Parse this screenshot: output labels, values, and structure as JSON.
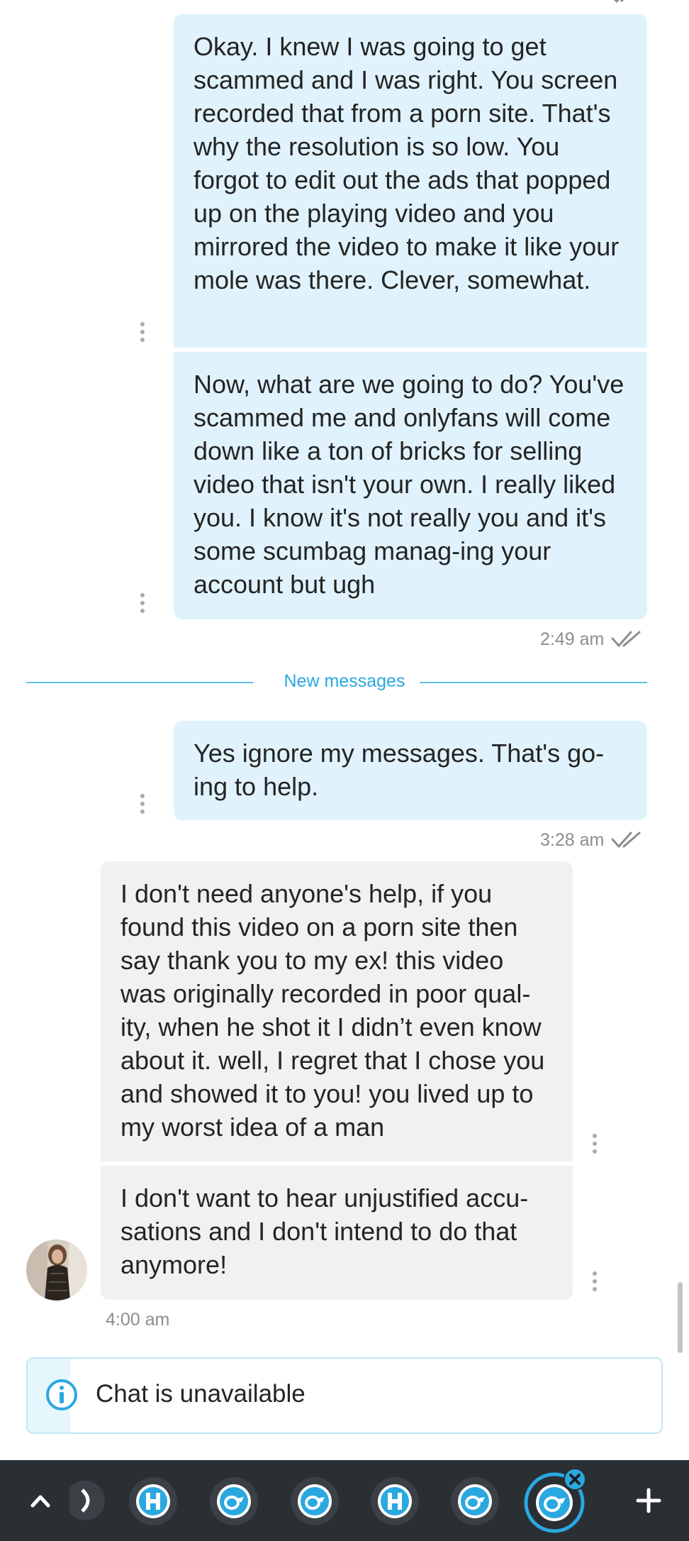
{
  "messages": [
    {
      "direction": "outgoing",
      "text": "Okay. I knew I was going to get scammed and I was right. You screen recorded that from a porn site. That's why the resolution is so low. You forgot to edit out the ads that popped up on the playing video and you mirrored the video to make it like your mole was there. Clever, somewhat."
    },
    {
      "direction": "outgoing",
      "text": "Now, what are we going to do? You've scammed me and onlyfans will come down like a ton of bricks for selling video that isn't your own. I really liked you. I know it's not really you and it's some scumbag manag-ing your account but ugh"
    },
    {
      "direction": "outgoing",
      "text": "Yes ignore my messages. That's go-ing to help."
    },
    {
      "direction": "incoming",
      "text": "I don't need anyone's help, if you found this video on a porn site then say thank you to my ex! this video was originally recorded in poor qual-ity, when he shot it I didn’t even know about it. well, I regret that I chose you and showed it to you! you lived up to my worst idea of a man"
    },
    {
      "direction": "incoming",
      "text": "I don't want to hear unjustified accu-sations and I don't intend to do that anymore!"
    }
  ],
  "timestamps": {
    "first_group": "2:49 am",
    "second_group": "3:28 am",
    "incoming_group": "4:00 am"
  },
  "divider": {
    "label": "New messages"
  },
  "notice": {
    "text": "Chat is unavailable",
    "icon": "info-icon"
  },
  "taskbar": {
    "items": [
      "chevron-up-icon",
      "partial-app-icon",
      "h-app-icon",
      "of-app-icon",
      "of-app-icon",
      "h-app-icon",
      "of-app-icon",
      "of-app-active-icon",
      "plus-icon"
    ]
  },
  "colors": {
    "outgoing_bubble": "#e0f3fc",
    "incoming_bubble": "#f0f1f2",
    "accent": "#2aa8e0",
    "taskbar": "#2a2f34"
  }
}
